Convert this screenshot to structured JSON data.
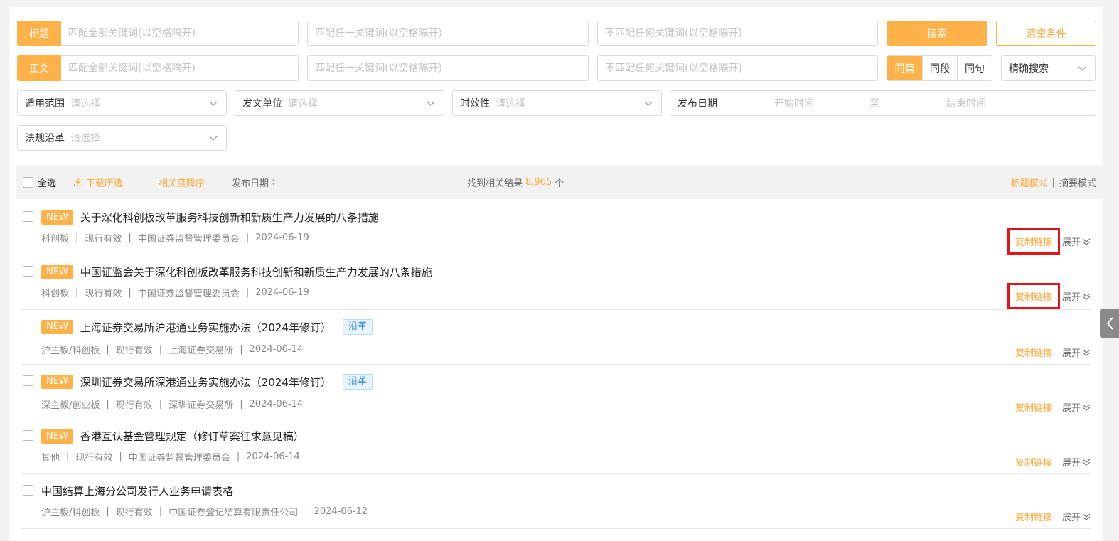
{
  "search": {
    "title_label": "标题",
    "body_label": "正文",
    "placeholder_all": "匹配全部关键词(以空格隔开)",
    "placeholder_any": "匹配任一关键词(以空格隔开)",
    "placeholder_none": "不匹配任何关键词(以空格隔开)",
    "search_button": "搜索",
    "clear_button": "清空条件",
    "scope_options": [
      "同篇",
      "同段",
      "同句"
    ],
    "match_mode": "精确搜索"
  },
  "filters": {
    "scope_label": "适用范围",
    "issuer_label": "发文单位",
    "validity_label": "时效性",
    "date_label": "发布日期",
    "evolution_label": "法规沿革",
    "select_placeholder": "请选择",
    "date_start": "开始时间",
    "date_to": "至",
    "date_end": "结束时间"
  },
  "toolbar": {
    "select_all": "全选",
    "download": "下载所选",
    "sort_relevance": "相关度降序",
    "sort_date": "发布日期",
    "result_prefix": "找到相关结果",
    "result_count": "8,965",
    "result_suffix": "个",
    "mode_title": "标题模式",
    "mode_sep": "|",
    "mode_summary": "摘要模式"
  },
  "results": [
    {
      "new": "NEW",
      "title": "关于深化科创板改革服务科技创新和新质生产力发展的八条措施",
      "tag": "",
      "meta": [
        "科创板",
        "现行有效",
        "中国证券监督管理委员会",
        "2024-06-19"
      ],
      "copy": "复制链接",
      "expand": "展开"
    },
    {
      "new": "NEW",
      "title": "中国证监会关于深化科创板改革服务科技创新和新质生产力发展的八条措施",
      "tag": "",
      "meta": [
        "科创板",
        "现行有效",
        "中国证券监督管理委员会",
        "2024-06-19"
      ],
      "copy": "复制链接",
      "expand": "展开"
    },
    {
      "new": "NEW",
      "title": "上海证券交易所沪港通业务实施办法（2024年修订）",
      "tag": "沿革",
      "meta": [
        "沪主板/科创板",
        "现行有效",
        "上海证券交易所",
        "2024-06-14"
      ],
      "copy": "复制链接",
      "expand": "展开"
    },
    {
      "new": "NEW",
      "title": "深圳证券交易所深港通业务实施办法（2024年修订）",
      "tag": "沿革",
      "meta": [
        "深主板/创业板",
        "现行有效",
        "深圳证券交易所",
        "2024-06-14"
      ],
      "copy": "复制链接",
      "expand": "展开"
    },
    {
      "new": "NEW",
      "title": "香港互认基金管理规定（修订草案征求意见稿）",
      "tag": "",
      "meta": [
        "其他",
        "现行有效",
        "中国证券监督管理委员会",
        "2024-06-14"
      ],
      "copy": "复制链接",
      "expand": "展开"
    },
    {
      "new": "",
      "title": "中国结算上海分公司发行人业务申请表格",
      "tag": "",
      "meta": [
        "沪主板/科创板",
        "现行有效",
        "中国证券登记结算有限责任公司",
        "2024-06-12"
      ],
      "copy": "复制链接",
      "expand": "展开"
    }
  ],
  "meta_sep": "|",
  "colors": {
    "accent": "#ffb24a",
    "highlight": "#e5141b",
    "tag_blue": "#3a8ee6"
  },
  "icons": {
    "chevron": "chevron-down-icon",
    "download": "download-icon",
    "sort": "sort-icon",
    "side": "chevron-left-icon"
  }
}
